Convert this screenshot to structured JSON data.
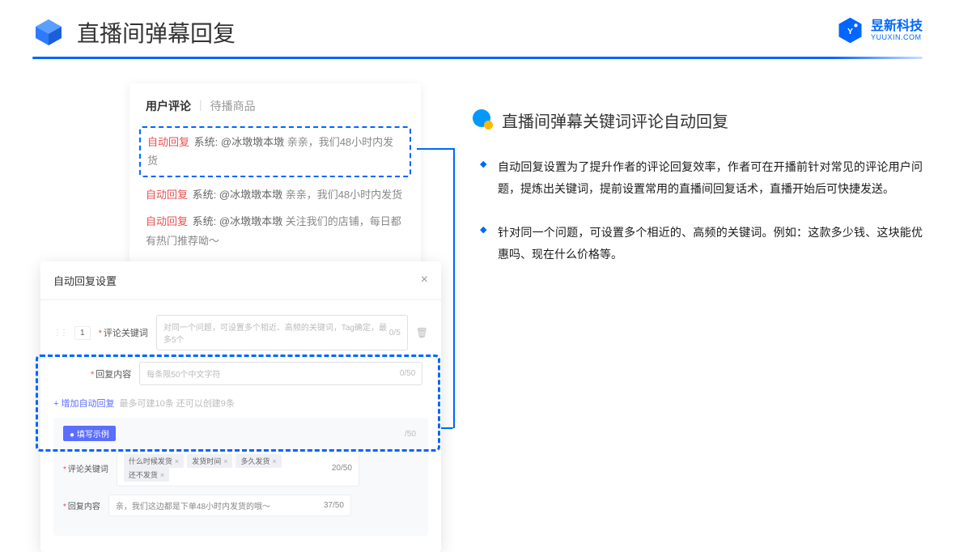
{
  "header": {
    "title": "直播间弹幕回复",
    "logo": {
      "cn": "昱新科技",
      "en": "YUUXIN.COM"
    }
  },
  "comments": {
    "tabActive": "用户评论",
    "tabInactive": "待播商品",
    "items": [
      {
        "auto": "自动回复",
        "sys": "系统:",
        "mention": "@冰墩墩本墩",
        "msg": " 亲亲，我们48小时内发货"
      },
      {
        "auto": "自动回复",
        "sys": "系统:",
        "mention": "@冰墩墩本墩",
        "msg": " 亲亲，我们48小时内发货"
      },
      {
        "auto": "自动回复",
        "sys": "系统:",
        "mention": "@冰墩墩本墩",
        "msg": " 关注我们的店铺，每日都有热门推荐呦～"
      }
    ]
  },
  "settings": {
    "title": "自动回复设置",
    "rowNum": "1",
    "kwLabel": "评论关键词",
    "kwPlaceholder": "对同一个问题，可设置多个相近、高频的关键词，Tag确定，最多5个",
    "kwCount": "0/5",
    "replyLabel": "回复内容",
    "replyPlaceholder": "每条限50个中文字符",
    "replyCount": "0/50",
    "addLink": "+ 增加自动回复",
    "addHint": "最多可建10条 还可以创建9条",
    "exampleBadge": "● 填写示例",
    "exKwLabel": "评论关键词",
    "exTags": [
      "什么时候发货",
      "发货时间",
      "多久发货",
      "还不发货"
    ],
    "exKwCount": "20/50",
    "exReplyLabel": "回复内容",
    "exReplyText": "亲，我们这边都是下单48小时内发货的哦～",
    "exReplyCount": "37/50",
    "trailing50": "/50"
  },
  "right": {
    "title": "直播间弹幕关键词评论自动回复",
    "bullets": [
      "自动回复设置为了提升作者的评论回复效率，作者可在开播前针对常见的评论用户问题，提炼出关键词，提前设置常用的直播间回复话术，直播开始后可快捷发送。",
      "针对同一个问题，可设置多个相近的、高频的关键词。例如：这款多少钱、这块能优惠吗、现在什么价格等。"
    ]
  }
}
